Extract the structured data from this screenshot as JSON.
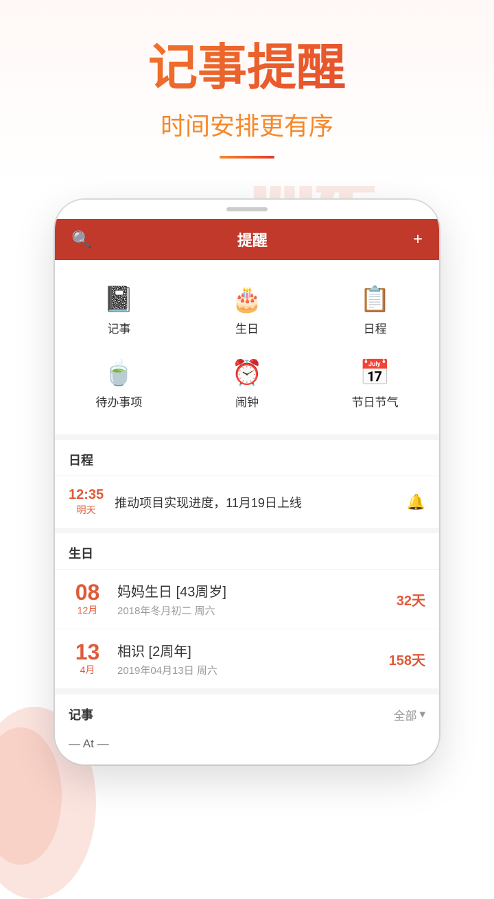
{
  "hero": {
    "title": "记事提醒",
    "subtitle": "时间安排更有序",
    "bg_text": "提醒"
  },
  "header": {
    "title": "提醒",
    "search_icon": "🔍",
    "add_icon": "+"
  },
  "grid": {
    "items": [
      {
        "icon": "📓",
        "label": "记事",
        "unicode": "📓"
      },
      {
        "icon": "🎂",
        "label": "生日",
        "unicode": "🎂"
      },
      {
        "icon": "📋",
        "label": "日程",
        "unicode": "📋"
      },
      {
        "icon": "☕",
        "label": "待办事项",
        "unicode": "☕"
      },
      {
        "icon": "⏰",
        "label": "闹钟",
        "unicode": "⏰"
      },
      {
        "icon": "📅",
        "label": "节日节气",
        "unicode": "📅"
      }
    ]
  },
  "schedule_section": {
    "title": "日程",
    "item": {
      "time": "12:35",
      "day": "明天",
      "text": "推动项目实现进度，11月19日上线"
    }
  },
  "birthday_section": {
    "title": "生日",
    "items": [
      {
        "day": "08",
        "month": "12月",
        "name": "妈妈生日 [43周岁]",
        "date_detail": "2018年冬月初二 周六",
        "days_left": "32天"
      },
      {
        "day": "13",
        "month": "4月",
        "name": "相识 [2周年]",
        "date_detail": "2019年04月13日 周六",
        "days_left": "158天"
      }
    ]
  },
  "notes_section": {
    "title": "记事",
    "filter": "全部",
    "preview": "— At —"
  }
}
